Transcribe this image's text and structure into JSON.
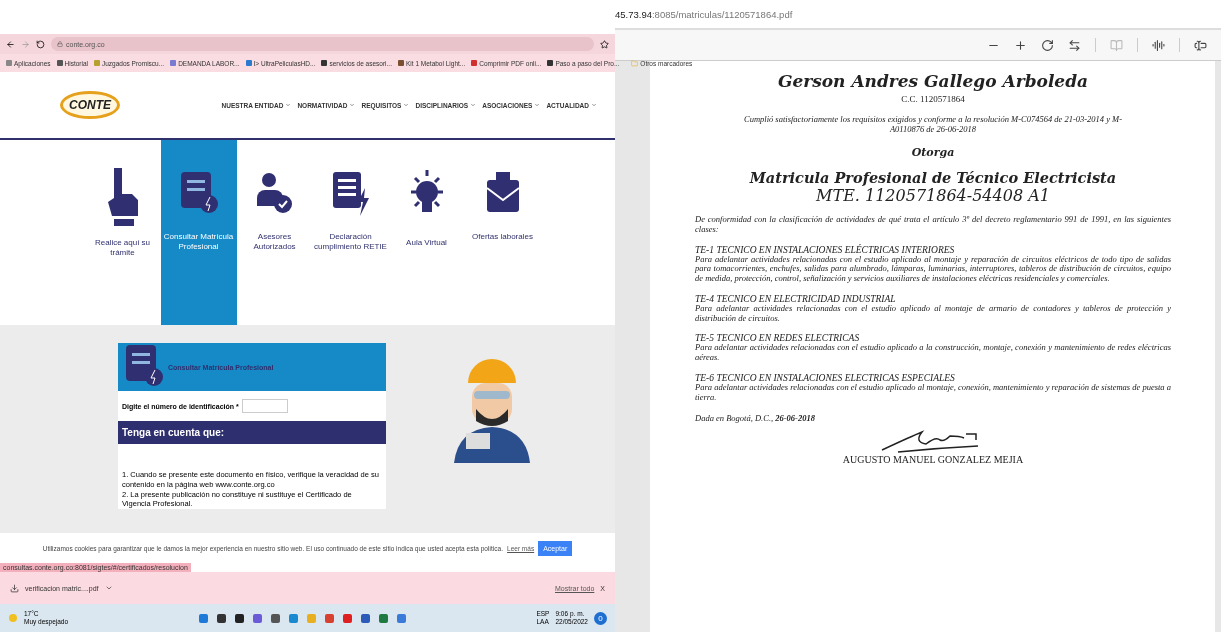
{
  "browser": {
    "url": "conte.org.co",
    "bookmarks": [
      "Aplicaciones",
      "Historial",
      "Juzgados Promiscu...",
      "DEMANDA LABOR...",
      "I> UltraPeliculasHD...",
      "servicios de asesori...",
      "Kit 1 Metabol Light...",
      "Comprimir PDF onli...",
      "Paso a paso del Pro..."
    ],
    "other_bookmarks": "Otros marcadores",
    "site": {
      "logo": "CONTE",
      "nav": [
        "NUESTRA ENTIDAD",
        "NORMATIVIDAD",
        "REQUISITOS",
        "DISCIPLINARIOS",
        "ASOCIACIONES",
        "ACTUALIDAD"
      ],
      "tiles": [
        {
          "label": "Realice aquí su trámite",
          "selected": false
        },
        {
          "label": "Consultar Matrícula Profesional",
          "selected": true
        },
        {
          "label": "Asesores Autorizados",
          "selected": false
        },
        {
          "label": "Declaración cumplimiento RETIE",
          "selected": false
        },
        {
          "label": "Aula Virtual",
          "selected": false
        },
        {
          "label": "Ofertas laborales",
          "selected": false
        }
      ],
      "form": {
        "title": "Consultar Matrícula Profesional",
        "field_label": "Digite el número de identificación",
        "required_mark": "*",
        "notice_heading": "Tenga en cuenta que:",
        "notes": [
          "1. Cuando se presente este documento en físico, verifique la veracidad de su contenido en la página web www.conte.org.co",
          "2. La presente publicación no constituye ni sustituye el Certificado de Vigencia Profesional."
        ]
      }
    },
    "cookie_banner": {
      "text": "Utilizamos cookies para garantizar que le damos la mejor experiencia en nuestro sitio web. El uso continuado de este sitio indica que usted acepta esta política.",
      "link": "Leer más",
      "button": "Aceptar"
    },
    "status_url": "consultas.conte.org.co:8081/sigtes/#/certificados/resolucion",
    "downloads": {
      "file": "verificacion matric....pdf",
      "show_all": "Mostrar todo",
      "close": "X"
    },
    "taskbar": {
      "temperature": "17°C",
      "weather": "Muy despejado",
      "language": "ESP",
      "layout": "LAA",
      "time": "9:06 p. m.",
      "date": "22/05/2022",
      "notifications": "0"
    }
  },
  "pdf_viewer": {
    "url_host": "45.73.94",
    "url_path": ":8085/matriculas/1120571864.pdf",
    "document": {
      "name": "Gerson Andres Gallego Arboleda",
      "id": "C.C. 1120571864",
      "statement": "Cumplió satisfactoriamente los requisitos exigidos y conforme a la resolución M-C074564 de 21-03-2014 y M-A0110876 de 26-06-2018",
      "grants": "Otorga",
      "title": "Matricula Profesional de Técnico Electricista",
      "code": "MTE. 1120571864-54408 A1",
      "intro": "De conformidad con la clasificación de actividades de qué trata el artículo 3º del decreto reglamentario 991 de 1991, en las siguientes clases:",
      "classes": [
        {
          "heading": "TE-1 TECNICO EN INSTALACIONES ELÉCTRICAS INTERIORES",
          "text": "Para adelantar actividades relacionadas con el estudio aplicado al montaje y reparación de circuitos eléctricos de todo tipo de salidas para tomacorrientes, enchufes, salidas para alumbrado, lámparas, luminarias, interruptores, tableros de distribución de circuitos, equipo de medida, protección, control, señalización y servicios auxiliares de instalaciones eléctricas residenciales y comerciales."
        },
        {
          "heading": "TE-4 TECNICO EN ELECTRICIDAD INDUSTRIAL",
          "text": "Para adelantar actividades relacionadas con el estudio aplicado al montaje de armario de contadores y tableros de protección y distribución de circuitos."
        },
        {
          "heading": "TE-5 TECNICO EN REDES ELECTRICAS",
          "text": "Para adelantar actividades relacionadas con el estudio aplicado a la construcción, montaje, conexión y mantenimiento de redes eléctricas aéreas."
        },
        {
          "heading": "TE-6 TECNICO EN INSTALACIONES ELECTRICAS ESPECIALES",
          "text": "Para adelantar actividades relacionadas con el estudio aplicado al montaje, conexión, mantenimiento y reparación de sistemas de puesta a tierra."
        }
      ],
      "issued": "Dada en Bogotá, D.C., **26-06-2018**",
      "signer": "AUGUSTO MANUEL GONZALEZ MEJIA"
    }
  }
}
